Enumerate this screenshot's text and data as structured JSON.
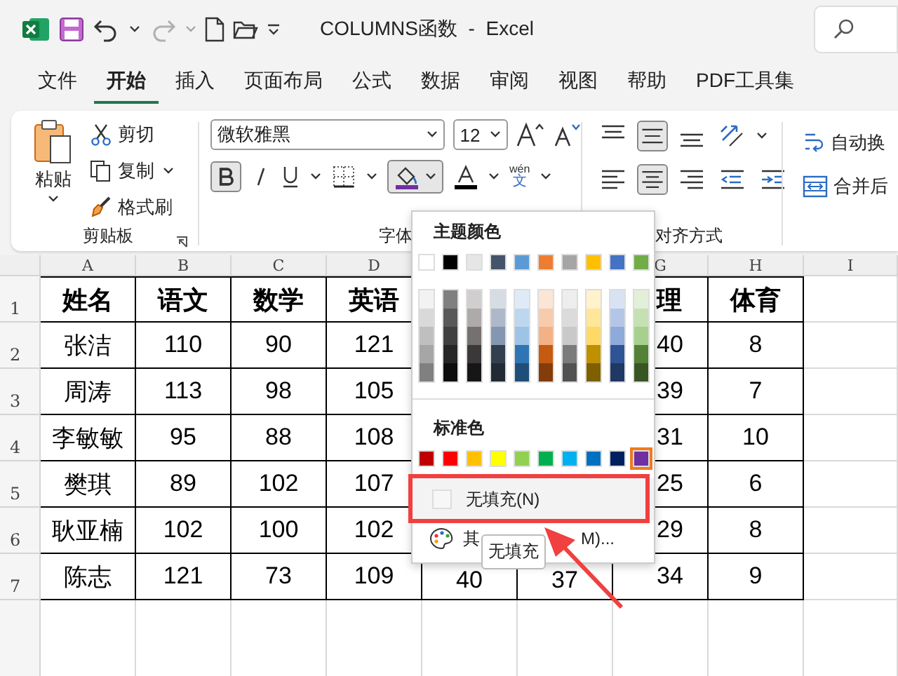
{
  "title_bar": {
    "title": "COLUMNS函数  -  Excel",
    "redo_disabled": true
  },
  "tabs": [
    {
      "label": "文件",
      "selected": false
    },
    {
      "label": "开始",
      "selected": true
    },
    {
      "label": "插入",
      "selected": false
    },
    {
      "label": "页面布局",
      "selected": false
    },
    {
      "label": "公式",
      "selected": false
    },
    {
      "label": "数据",
      "selected": false
    },
    {
      "label": "审阅",
      "selected": false
    },
    {
      "label": "视图",
      "selected": false
    },
    {
      "label": "帮助",
      "selected": false
    },
    {
      "label": "PDF工具集",
      "selected": false
    }
  ],
  "ribbon": {
    "clipboard": {
      "paste": "粘贴",
      "cut": "剪切",
      "copy": "复制",
      "format_painter": "格式刷",
      "group_label": "剪贴板"
    },
    "font": {
      "font_name": "微软雅黑",
      "font_size": "12",
      "bold": true,
      "fill_open": true,
      "pinyin_top": "wén",
      "pinyin_char": "文",
      "group_label": "字体"
    },
    "alignment": {
      "middle_align": true,
      "center_align": true,
      "wrap_text": "自动换",
      "merge": "合并后",
      "group_label": "对齐方式"
    }
  },
  "sheet": {
    "columns": [
      {
        "label": "A"
      },
      {
        "label": "B"
      },
      {
        "label": "C"
      },
      {
        "label": "D"
      },
      {},
      {},
      {
        "label": "G"
      },
      {
        "label": "H"
      },
      {
        "label": "I"
      }
    ],
    "rows": [
      {
        "number": "1",
        "cells": [
          "姓名",
          "语文",
          "数学",
          "英语",
          null,
          null,
          "理",
          "体育"
        ]
      },
      {
        "number": "2",
        "cells": [
          "张洁",
          "110",
          "90",
          "121",
          null,
          null,
          "40",
          "8"
        ]
      },
      {
        "number": "3",
        "cells": [
          "周涛",
          "113",
          "98",
          "105",
          null,
          null,
          "39",
          "7"
        ]
      },
      {
        "number": "4",
        "cells": [
          "李敏敏",
          "95",
          "88",
          "108",
          null,
          null,
          "31",
          "10"
        ]
      },
      {
        "number": "5",
        "cells": [
          "樊琪",
          "89",
          "102",
          "107",
          null,
          null,
          "25",
          "6"
        ]
      },
      {
        "number": "6",
        "cells": [
          "耿亚楠",
          "102",
          "100",
          "102",
          null,
          null,
          "29",
          "8"
        ]
      },
      {
        "number": "7",
        "cells": [
          "陈志",
          "121",
          "73",
          "109",
          "40",
          "37",
          "34",
          "9"
        ]
      }
    ]
  },
  "color_menu": {
    "theme_title": "主题颜色",
    "theme_colors": [
      {
        "color": "#ffffff",
        "selected": false
      },
      {
        "color": "#000000",
        "selected": false
      },
      {
        "color": "#e7e6e6",
        "selected": false
      },
      {
        "color": "#44546a",
        "selected": false
      },
      {
        "color": "#5b9bd5",
        "selected": false
      },
      {
        "color": "#ed7d31",
        "selected": false
      },
      {
        "color": "#a5a5a5",
        "selected": false
      },
      {
        "color": "#ffc000",
        "selected": false
      },
      {
        "color": "#4472c4",
        "selected": false
      },
      {
        "color": "#70ad47",
        "selected": false
      }
    ],
    "shades": [
      [
        {
          "color": "#f2f2f2",
          "selected": false
        },
        {
          "color": "#d9d9d9",
          "selected": false
        },
        {
          "color": "#bfbfbf",
          "selected": false
        },
        {
          "color": "#a6a6a6",
          "selected": false
        },
        {
          "color": "#808080",
          "selected": false
        }
      ],
      [
        {
          "color": "#7f7f7f",
          "selected": false
        },
        {
          "color": "#595959",
          "selected": false
        },
        {
          "color": "#404040",
          "selected": false
        },
        {
          "color": "#262626",
          "selected": false
        },
        {
          "color": "#0d0d0d",
          "selected": false
        }
      ],
      [
        {
          "color": "#d0cece",
          "selected": false
        },
        {
          "color": "#aeaaaa",
          "selected": false
        },
        {
          "color": "#757171",
          "selected": false
        },
        {
          "color": "#3a3838",
          "selected": false
        },
        {
          "color": "#171616",
          "selected": false
        }
      ],
      [
        {
          "color": "#d6dce4",
          "selected": false
        },
        {
          "color": "#adb9ca",
          "selected": false
        },
        {
          "color": "#8496b0",
          "selected": false
        },
        {
          "color": "#333f4f",
          "selected": false
        },
        {
          "color": "#222a35",
          "selected": false
        }
      ],
      [
        {
          "color": "#deebf6",
          "selected": false
        },
        {
          "color": "#bdd7ee",
          "selected": false
        },
        {
          "color": "#9dc3e6",
          "selected": false
        },
        {
          "color": "#2e75b5",
          "selected": false
        },
        {
          "color": "#1f4e79",
          "selected": false
        }
      ],
      [
        {
          "color": "#fbe5d5",
          "selected": false
        },
        {
          "color": "#f8cbad",
          "selected": false
        },
        {
          "color": "#f4b183",
          "selected": false
        },
        {
          "color": "#c55a11",
          "selected": false
        },
        {
          "color": "#843c0b",
          "selected": false
        }
      ],
      [
        {
          "color": "#ededed",
          "selected": false
        },
        {
          "color": "#dbdbdb",
          "selected": false
        },
        {
          "color": "#c9c9c9",
          "selected": false
        },
        {
          "color": "#7b7b7b",
          "selected": false
        },
        {
          "color": "#525252",
          "selected": false
        }
      ],
      [
        {
          "color": "#fff2cc",
          "selected": false
        },
        {
          "color": "#ffe699",
          "selected": false
        },
        {
          "color": "#ffd966",
          "selected": false
        },
        {
          "color": "#bf9000",
          "selected": false
        },
        {
          "color": "#7f6000",
          "selected": false
        }
      ],
      [
        {
          "color": "#d9e2f3",
          "selected": false
        },
        {
          "color": "#b4c6e7",
          "selected": false
        },
        {
          "color": "#8eaadb",
          "selected": false
        },
        {
          "color": "#2f5496",
          "selected": false
        },
        {
          "color": "#1f3864",
          "selected": false
        }
      ],
      [
        {
          "color": "#e2efd9",
          "selected": false
        },
        {
          "color": "#c5e0b3",
          "selected": false
        },
        {
          "color": "#a8d08d",
          "selected": false
        },
        {
          "color": "#538135",
          "selected": false
        },
        {
          "color": "#375623",
          "selected": false
        }
      ]
    ],
    "standard_title": "标准色",
    "standard_colors": [
      {
        "color": "#c00000",
        "selected": false
      },
      {
        "color": "#ff0000",
        "selected": false
      },
      {
        "color": "#ffc000",
        "selected": false
      },
      {
        "color": "#ffff00",
        "selected": false
      },
      {
        "color": "#92d050",
        "selected": false
      },
      {
        "color": "#00b050",
        "selected": false
      },
      {
        "color": "#00b0f0",
        "selected": false
      },
      {
        "color": "#0070c0",
        "selected": false
      },
      {
        "color": "#002060",
        "selected": false
      },
      {
        "color": "#7030a0",
        "selected": true
      }
    ],
    "no_fill": {
      "label": "无填充(N)",
      "highlighted": true
    },
    "more_colors": {
      "label_start": "其",
      "label_end": "M)..."
    },
    "tooltip": "无填充"
  }
}
